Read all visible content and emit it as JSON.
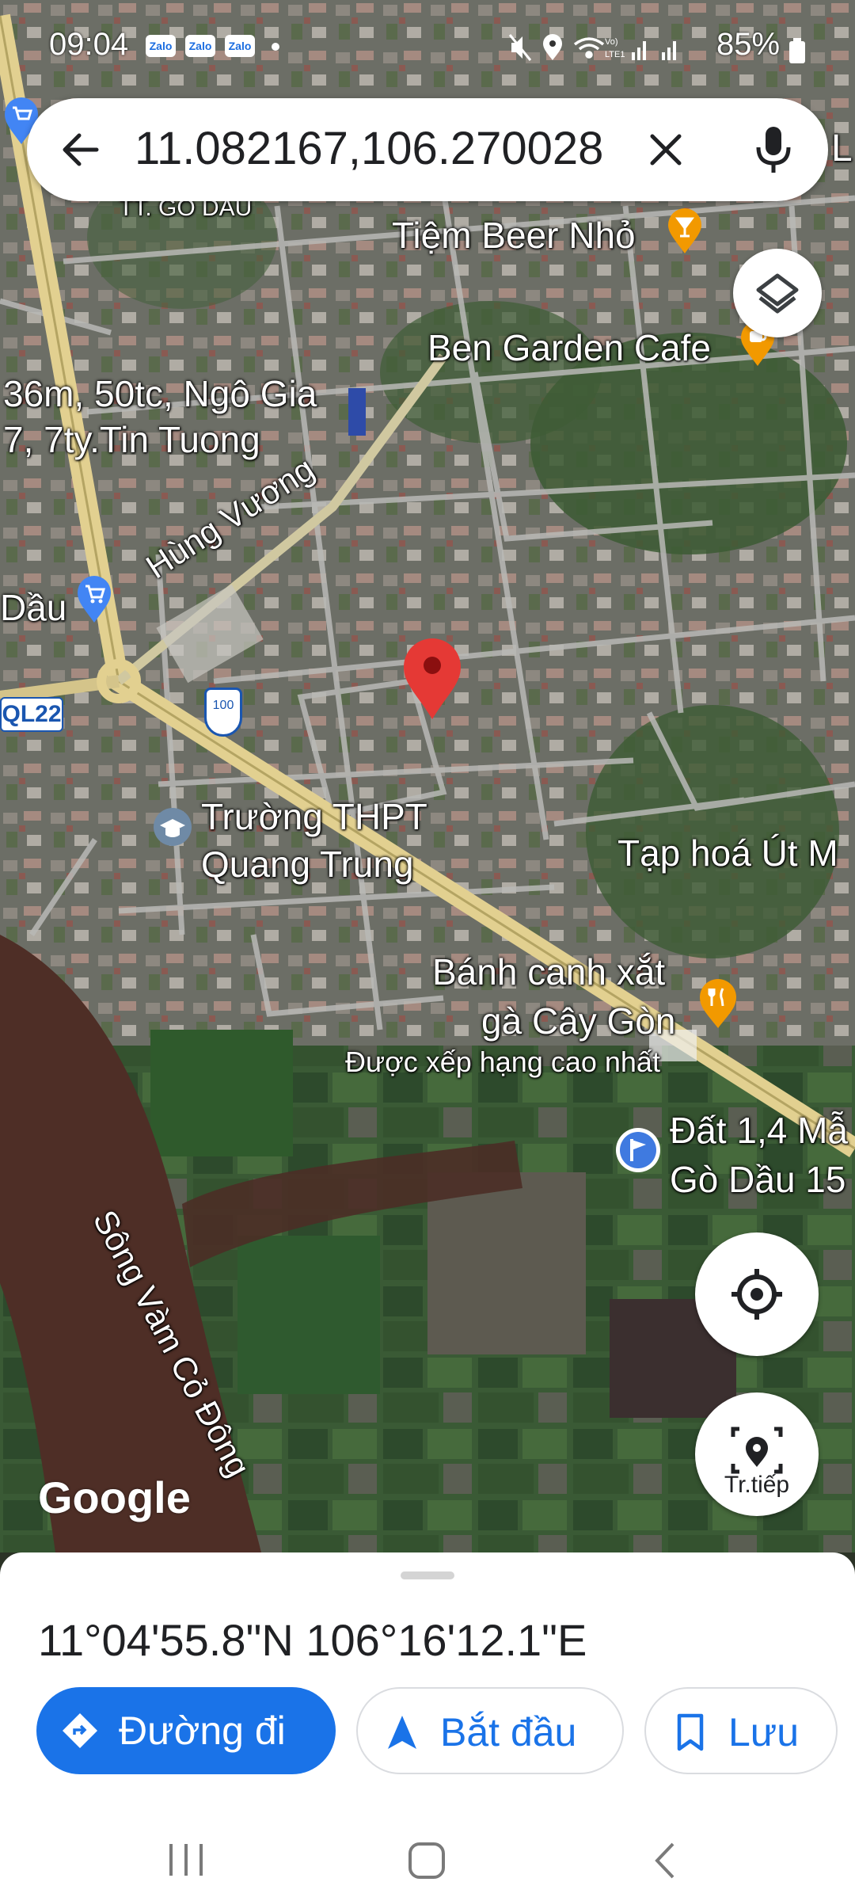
{
  "status_bar": {
    "time": "09:04",
    "notifications": [
      "Zalo",
      "Zalo",
      "Zalo"
    ],
    "battery": "85%",
    "network_label": "Vo) LTE1"
  },
  "search": {
    "query": "11.082167,106.270028",
    "back_icon": "arrow-back-icon",
    "clear_icon": "close-icon",
    "mic_icon": "mic-icon",
    "edge_text": "L"
  },
  "map": {
    "labels": {
      "go_dau": "TT. GÒ DẦU",
      "beer": "Tiệm Beer Nhỏ",
      "ben_garden": "Ben Garden Cafe",
      "listing_line1": "36m, 50tc, Ngô Gia",
      "listing_line2": "7, 7ty.Tin Tuong",
      "dau": "Dầu",
      "hung_vuong": "Hùng Vương",
      "ql22": "QL22",
      "route100": "100",
      "school_line1": "Trường THPT",
      "school_line2": "Quang Trung",
      "tap_hoa": "Tạp hoá Út M",
      "banh_canh_line1": "Bánh canh xắt",
      "banh_canh_line2": "gà Cây Gòn",
      "rating": "Được xếp hạng cao nhất",
      "dat_line1": "Đất 1,4 Mẫ",
      "dat_line2": "Gò Dầu 15",
      "river": "Sông Vàm Cỏ Đông"
    },
    "layers_icon": "layers-icon",
    "location_icon": "my-location-icon",
    "tracking_label": "Tr.tiếp",
    "google_logo": "Google"
  },
  "sheet": {
    "coords": "11°04'55.8\"N 106°16'12.1\"E",
    "directions_label": "Đường đi",
    "start_label": "Bắt đầu",
    "save_label": "Lưu"
  },
  "colors": {
    "accent": "#1a73e8",
    "pin_red": "#e53935",
    "poi_orange": "#f29900"
  }
}
